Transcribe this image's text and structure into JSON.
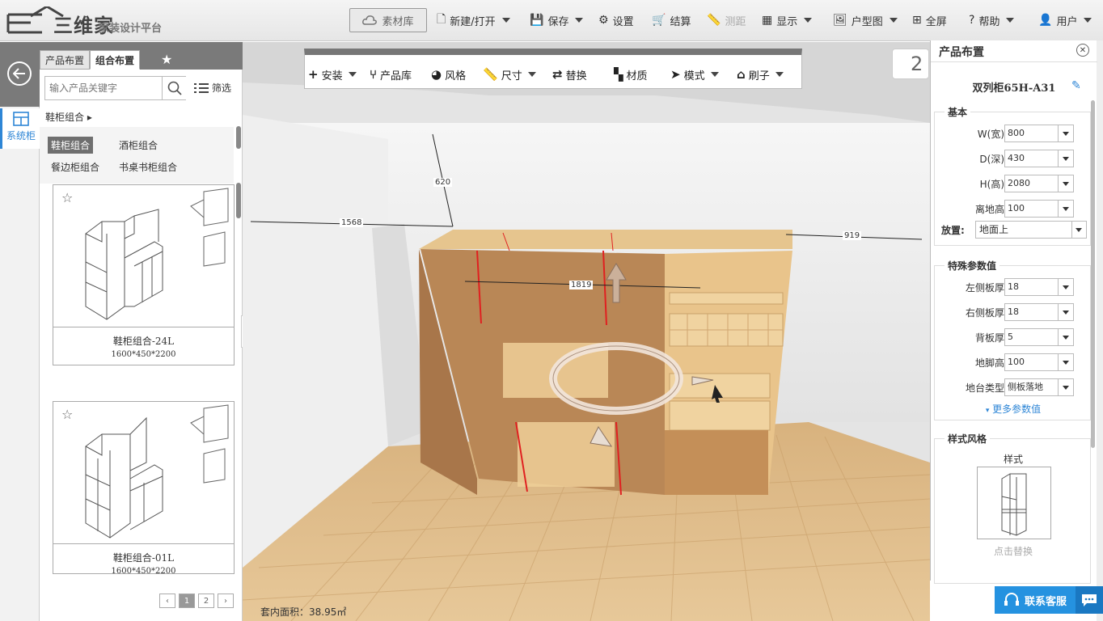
{
  "topbar": {
    "brand": "三维家",
    "subtitle": "家装设计平台",
    "material_lib": "素材库",
    "items": [
      {
        "label": "新建/打开",
        "icon": "file-icon",
        "caret": true
      },
      {
        "label": "保存",
        "icon": "save-icon",
        "caret": true
      },
      {
        "label": "设置",
        "icon": "gear-icon",
        "caret": false
      },
      {
        "label": "结算",
        "icon": "cart-icon",
        "caret": false
      },
      {
        "label": "测距",
        "icon": "ruler-icon",
        "caret": false,
        "disabled": true
      },
      {
        "label": "显示",
        "icon": "grid-icon",
        "caret": true
      },
      {
        "label": "户型图",
        "icon": "image-icon",
        "caret": true
      },
      {
        "label": "全屏",
        "icon": "fullscreen-icon",
        "caret": false
      },
      {
        "label": "帮助",
        "icon": "help-icon",
        "caret": true
      },
      {
        "label": "用户",
        "icon": "user-icon",
        "caret": true
      }
    ]
  },
  "leftrail": {
    "system_cabinet": "系统柜"
  },
  "panel": {
    "tabs": [
      "产品布置",
      "组合布置"
    ],
    "search_placeholder": "输入产品关键字",
    "filter": "筛选",
    "breadcrumb": "鞋柜组合",
    "categories": [
      "鞋柜组合",
      "酒柜组合",
      "餐边柜组合",
      "书桌书柜组合"
    ],
    "products": [
      {
        "name": "鞋柜组合-24L",
        "size": "1600*450*2200"
      },
      {
        "name": "鞋柜组合-01L",
        "size": "1600*450*2200"
      }
    ],
    "pages": [
      "1",
      "2"
    ]
  },
  "toolbar": {
    "items": [
      {
        "label": "安装",
        "icon": "plus-icon",
        "caret": true
      },
      {
        "label": "产品库",
        "icon": "chair-icon",
        "caret": false
      },
      {
        "label": "风格",
        "icon": "palette-icon",
        "caret": false
      },
      {
        "label": "尺寸",
        "icon": "ruler-icon",
        "caret": true
      },
      {
        "label": "替换",
        "icon": "swap-icon",
        "caret": false
      },
      {
        "label": "材质",
        "icon": "texture-icon",
        "caret": false
      },
      {
        "label": "模式",
        "icon": "cursor-icon",
        "caret": true
      },
      {
        "label": "刷子",
        "icon": "brush-icon",
        "caret": true
      }
    ]
  },
  "scene": {
    "dims": {
      "d620": "620",
      "d1568": "1568",
      "d919": "919",
      "d1819": "1819"
    },
    "area": "套内面积：38.95㎡",
    "room_tag": "2"
  },
  "sidebar": {
    "title": "产品布置",
    "product_name": "双列柜65H-A31",
    "basic_title": "基本",
    "basic": [
      {
        "label": "W(宽)",
        "value": "800"
      },
      {
        "label": "D(深)",
        "value": "430"
      },
      {
        "label": "H(高)",
        "value": "2080"
      },
      {
        "label": "离地高",
        "value": "100"
      }
    ],
    "placement_label": "放置:",
    "placement_value": "地面上",
    "special_title": "特殊参数值",
    "special": [
      {
        "label": "左侧板厚",
        "value": "18"
      },
      {
        "label": "右侧板厚",
        "value": "18"
      },
      {
        "label": "背板厚",
        "value": "5"
      },
      {
        "label": "地脚高",
        "value": "100"
      },
      {
        "label": "地台类型",
        "value": "侧板落地"
      }
    ],
    "more": "更多参数值",
    "style_title": "样式风格",
    "style_label": "样式",
    "replace": "点击替换"
  },
  "contact": "联系客服",
  "colors": {
    "accent": "#2e86d6",
    "wood": "#c9934f",
    "floor": "#d9b07c"
  }
}
